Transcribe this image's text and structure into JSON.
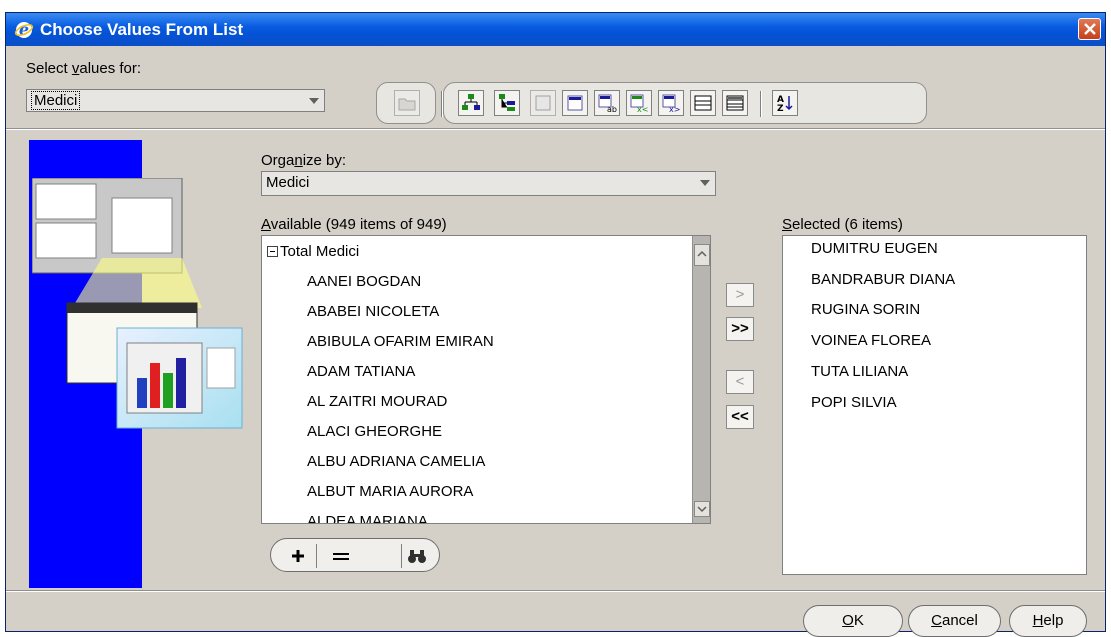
{
  "window": {
    "title": "Choose Values From List",
    "title_icon": "ie-icon",
    "close_icon": "close-icon"
  },
  "select_values": {
    "label": "Select values for:",
    "label_prefix": "Select ",
    "label_accel": "v",
    "label_suffix": "alues for:",
    "value": "Medici"
  },
  "toolbar": {
    "icons": [
      "folder-icon",
      "hierarchy-select-icon",
      "hierarchy-select-children-icon",
      "select-all-icon",
      "select-label-icon",
      "select-x-icon",
      "select-xy-icon",
      "list-view-icon",
      "tree-view-icon",
      "sort-icon"
    ]
  },
  "organize": {
    "label_prefix": "Orga",
    "label_accel": "n",
    "label_suffix": "ize by:",
    "value": "Medici"
  },
  "available": {
    "label_accel": "A",
    "label_rest": "vailable (949 items of 949)",
    "root": "Total Medici",
    "root_icon": "collapse-icon",
    "items": [
      "AANEI BOGDAN",
      "ABABEI NICOLETA",
      "ABIBULA OFARIM EMIRAN",
      "ADAM TATIANA",
      "AL ZAITRI MOURAD",
      "ALACI GHEORGHE",
      "ALBU ADRIANA CAMELIA",
      "ALBUT  MARIA AURORA",
      "ALDEA MARIANA"
    ]
  },
  "selected": {
    "label_accel": "S",
    "label_rest": "elected (6 items)",
    "items": [
      "DUMITRU EUGEN",
      "BANDRABUR DIANA",
      "RUGINA SORIN",
      "VOINEA FLOREA",
      "TUTA LILIANA",
      "POPI SILVIA"
    ]
  },
  "move_buttons": {
    "add": ">",
    "add_all": ">>",
    "remove": "<",
    "remove_all": "<<"
  },
  "list_tools": {
    "icons": [
      "add-condition-icon",
      "remove-condition-icon",
      "find-icon"
    ]
  },
  "footer": {
    "ok_accel": "O",
    "ok_rest": "K",
    "cancel_accel": "C",
    "cancel_rest": "ancel",
    "help_accel": "H",
    "help_rest": "elp"
  },
  "colors": {
    "title_bar": "#0a5de0",
    "dialog_bg": "#d4d0c8",
    "sidebar": "#0000ff"
  }
}
